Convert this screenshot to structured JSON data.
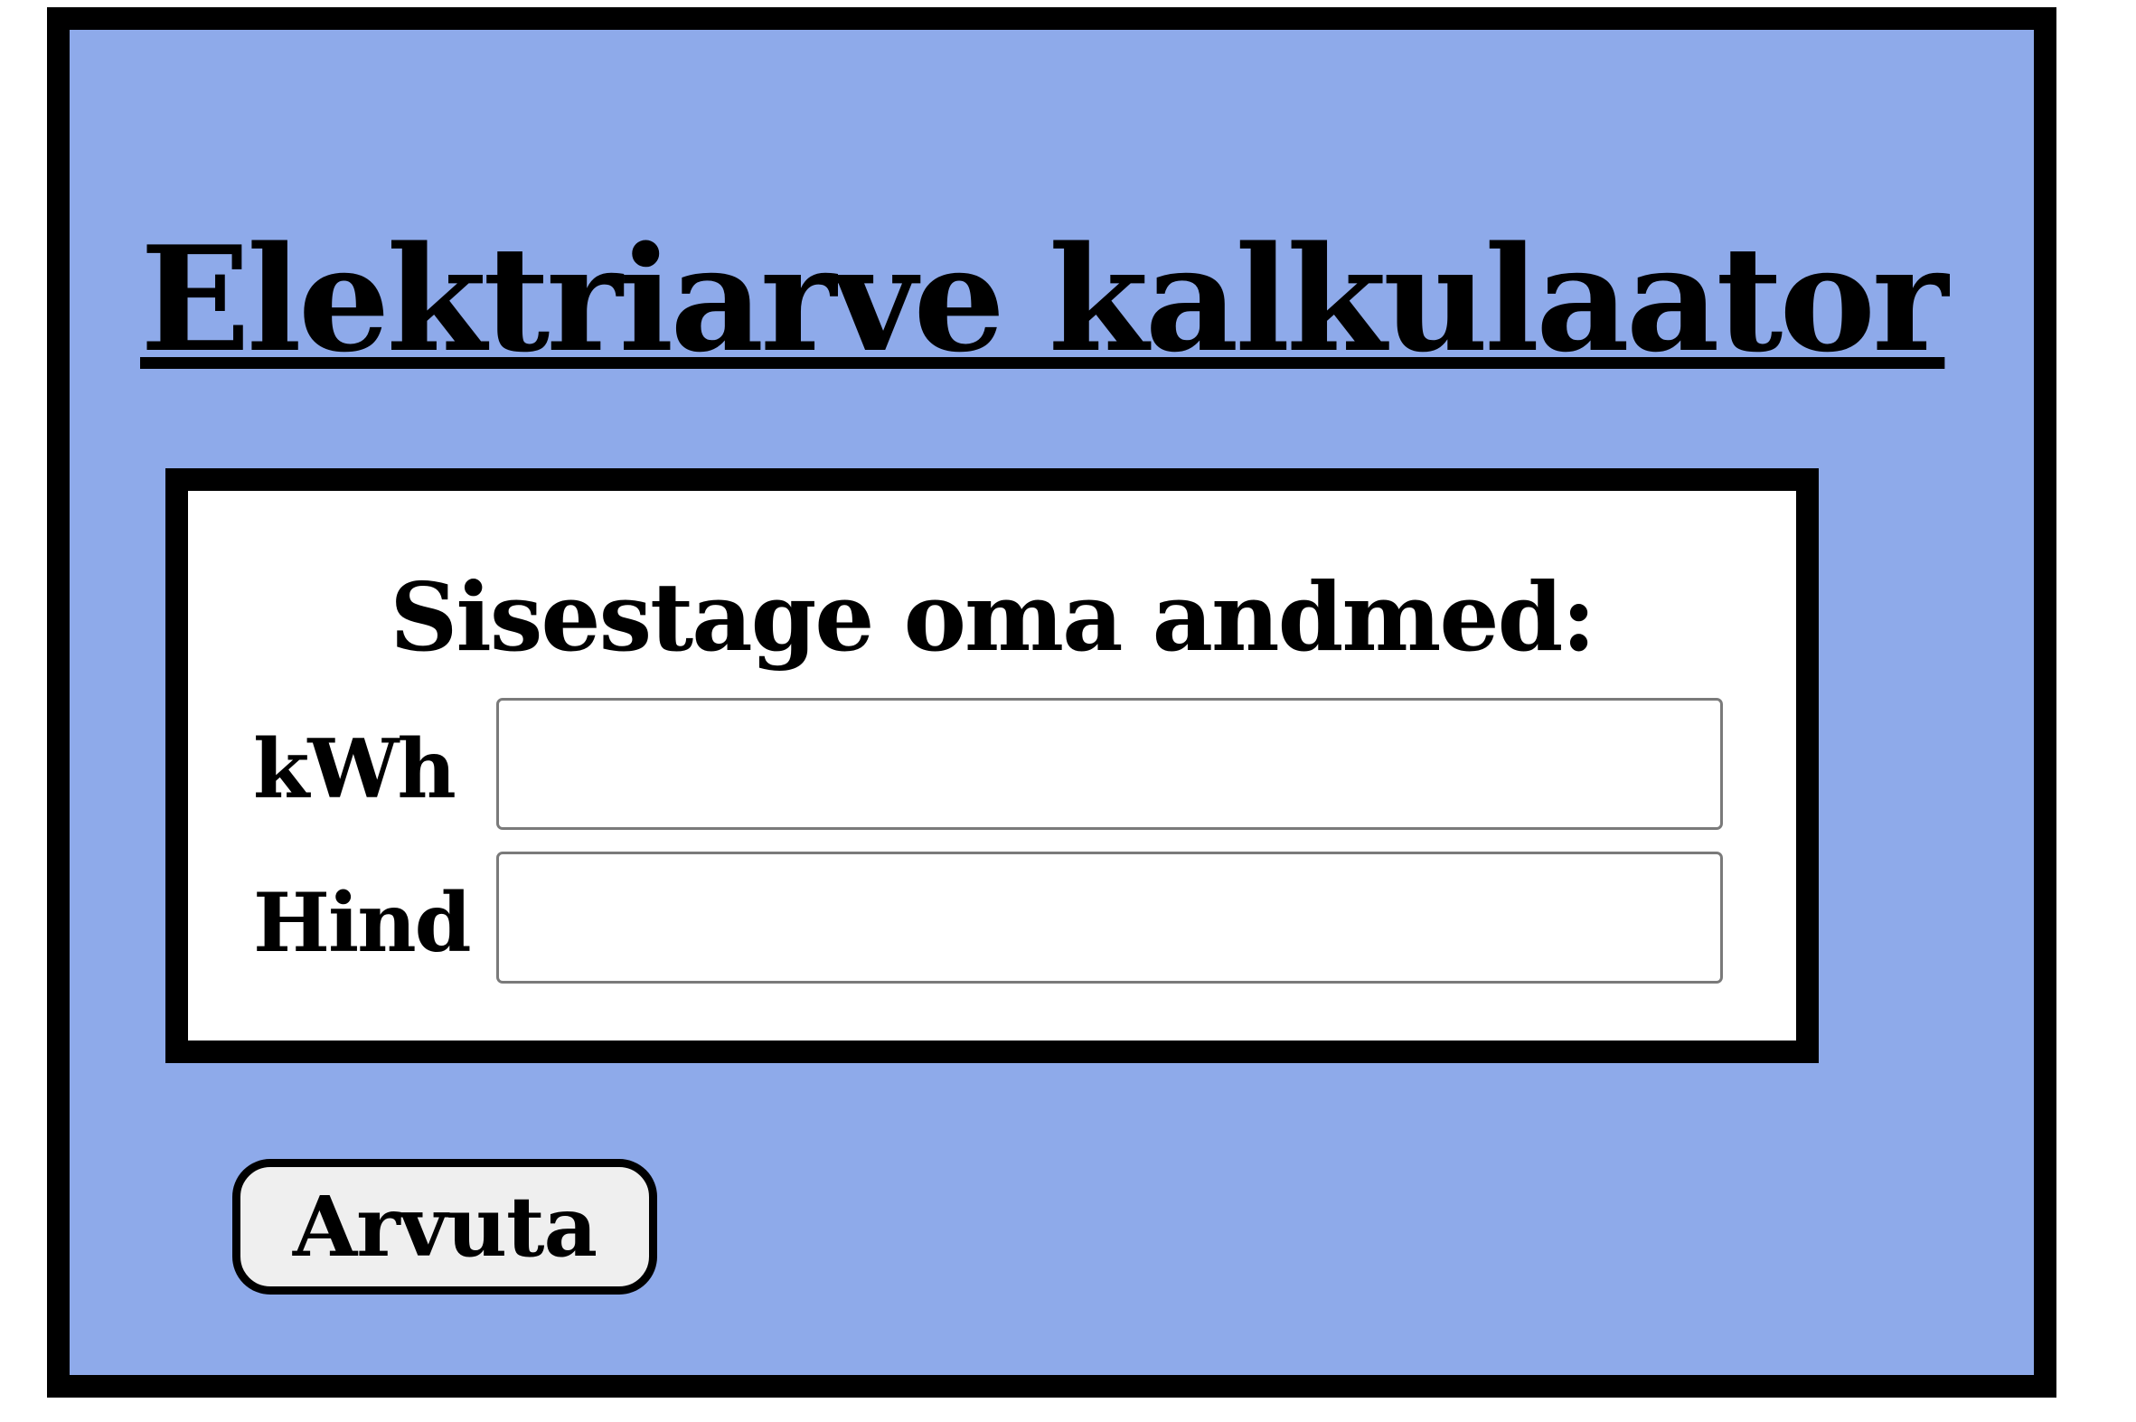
{
  "page": {
    "title": "Elektriarve kalkulaator"
  },
  "form": {
    "heading": "Sisestage oma andmed:",
    "fields": [
      {
        "label": "kWh",
        "value": "",
        "placeholder": ""
      },
      {
        "label": "Hind",
        "value": "",
        "placeholder": ""
      }
    ]
  },
  "actions": {
    "calculate_label": "Arvuta"
  },
  "colors": {
    "background": "#8eaaea",
    "border": "#000000",
    "card": "#ffffff",
    "button": "#efefef"
  }
}
